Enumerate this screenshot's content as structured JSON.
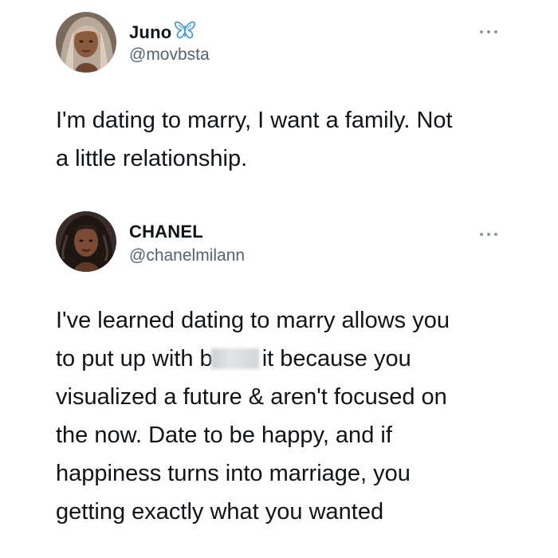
{
  "tweets": [
    {
      "display_name": "Juno",
      "verified_badge_icon": "butterfly-icon",
      "handle": "@movbsta",
      "text": "I'm dating to marry, I want a family. Not\na little relationship."
    },
    {
      "display_name": "CHANEL",
      "handle": "@chanelmilann",
      "text_line1": "I've learned dating to marry allows you",
      "text_line2_before": "to put up with b",
      "text_line2_after": "it because you",
      "text_rest": "visualized a future & aren't focused on\nthe now. Date to be happy, and if\nhappiness turns into marriage, you\ngetting exactly what you wanted"
    }
  ],
  "colors": {
    "text": "#0f1419",
    "secondary": "#536471",
    "butterfly": "#4a9fe0",
    "more_dots": "#8b98a5"
  },
  "icons": {
    "more": "more-options-icon",
    "butterfly": "butterfly-icon"
  }
}
